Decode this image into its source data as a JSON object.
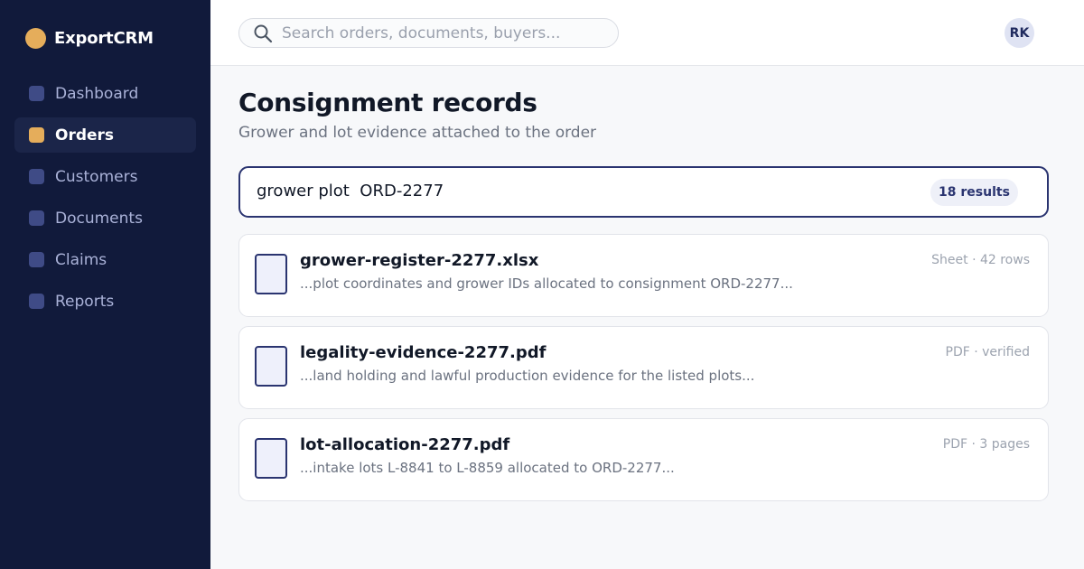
{
  "app": {
    "name": "ExportCRM",
    "brand_color": "#e5ad5b",
    "sidebar_color": "#111a3b",
    "accent_color": "#2a3470"
  },
  "sidebar": {
    "items": [
      {
        "label": "Dashboard",
        "icon": "dashboard-icon",
        "active": false
      },
      {
        "label": "Orders",
        "icon": "orders-icon",
        "active": true
      },
      {
        "label": "Customers",
        "icon": "customers-icon",
        "active": false
      },
      {
        "label": "Documents",
        "icon": "documents-icon",
        "active": false
      },
      {
        "label": "Claims",
        "icon": "claims-icon",
        "active": false
      },
      {
        "label": "Reports",
        "icon": "reports-icon",
        "active": false
      }
    ]
  },
  "header": {
    "search": {
      "placeholder": "Search orders, documents, buyers...",
      "value": "",
      "icon": "search-icon"
    },
    "avatar_initials": "RK"
  },
  "main": {
    "title": "Consignment records",
    "subtitle": "Grower and lot evidence attached to the order",
    "query": {
      "text": "grower plot  ORD-2277",
      "results_count": "18 results"
    },
    "results": [
      {
        "file_name": "grower-register-2277.xlsx",
        "snippet": "...plot coordinates and grower IDs allocated to consignment ORD-2277...",
        "meta": "Sheet · 42 rows",
        "icon": "file-icon"
      },
      {
        "file_name": "legality-evidence-2277.pdf",
        "snippet": "...land holding and lawful production evidence for the listed plots...",
        "meta": "PDF · verified",
        "icon": "file-icon"
      },
      {
        "file_name": "lot-allocation-2277.pdf",
        "snippet": "...intake lots L-8841 to L-8859 allocated to ORD-2277...",
        "meta": "PDF · 3 pages",
        "icon": "file-icon"
      }
    ]
  }
}
